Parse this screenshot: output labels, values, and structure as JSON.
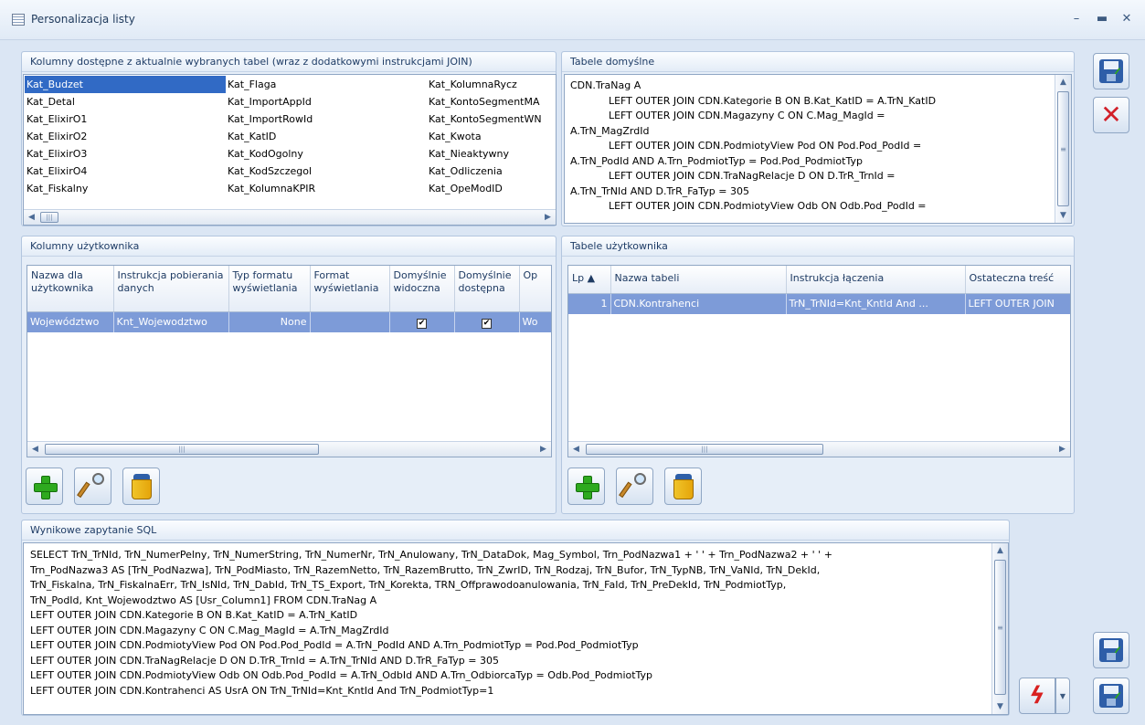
{
  "window": {
    "title": "Personalizacja listy"
  },
  "available_columns": {
    "title": "Kolumny dostępne z aktualnie wybranych tabel (wraz z dodatkowymi instrukcjami JOIN)",
    "columns": [
      [
        "Kat_Budzet",
        "Kat_Detal",
        "Kat_ElixirO1",
        "Kat_ElixirO2",
        "Kat_ElixirO3",
        "Kat_ElixirO4",
        "Kat_Fiskalny"
      ],
      [
        "Kat_Flaga",
        "Kat_ImportAppId",
        "Kat_ImportRowId",
        "Kat_KatID",
        "Kat_KodOgolny",
        "Kat_KodSzczegol",
        "Kat_KolumnaKPIR"
      ],
      [
        "Kat_KolumnaRycz",
        "Kat_KontoSegmentMA",
        "Kat_KontoSegmentWN",
        "Kat_Kwota",
        "Kat_Nieaktywny",
        "Kat_Odliczenia",
        "Kat_OpeModID"
      ]
    ],
    "selected": "Kat_Budzet"
  },
  "default_tables": {
    "title": "Tabele domyślne",
    "text": "CDN.TraNag A\n            LEFT OUTER JOIN CDN.Kategorie B ON B.Kat_KatID = A.TrN_KatID\n            LEFT OUTER JOIN CDN.Magazyny C ON C.Mag_MagId =\nA.TrN_MagZrdId\n            LEFT OUTER JOIN CDN.PodmiotyView Pod ON Pod.Pod_PodId =\nA.TrN_PodId AND A.Trn_PodmiotTyp = Pod.Pod_PodmiotTyp\n            LEFT OUTER JOIN CDN.TraNagRelacje D ON D.TrR_TrnId =\nA.TrN_TrNId AND D.TrR_FaTyp = 305\n            LEFT OUTER JOIN CDN.PodmiotyView Odb ON Odb.Pod_PodId ="
  },
  "user_columns": {
    "title": "Kolumny użytkownika",
    "headers": [
      "Nazwa dla użytkownika",
      "Instrukcja pobierania danych",
      "Typ formatu wyświetlania",
      "Format wyświetlania",
      "Domyślnie widoczna",
      "Domyślnie dostępna",
      "Op"
    ],
    "row": {
      "name": "Województwo",
      "instruction": "Knt_Wojewodztwo",
      "format_type": "None",
      "format": "",
      "visible": true,
      "available": true,
      "op": "Wo"
    }
  },
  "user_tables": {
    "title": "Tabele użytkownika",
    "headers": [
      "Lp ▲",
      "Nazwa tabeli",
      "Instrukcja łączenia",
      "Ostateczna treść"
    ],
    "row": {
      "lp": "1",
      "name": "CDN.Kontrahenci",
      "join": "TrN_TrNId=Knt_KntId And ...",
      "final": "LEFT OUTER JOIN"
    }
  },
  "sql": {
    "title": "Wynikowe zapytanie SQL",
    "text": "SELECT TrN_TrNId, TrN_NumerPelny, TrN_NumerString, TrN_NumerNr, TrN_Anulowany, TrN_DataDok, Mag_Symbol, Trn_PodNazwa1 + ' ' + Trn_PodNazwa2 + ' ' +\nTrn_PodNazwa3 AS [TrN_PodNazwa], TrN_PodMiasto, TrN_RazemNetto, TrN_RazemBrutto, TrN_ZwrID, TrN_Rodzaj, TrN_Bufor, TrN_TypNB, TrN_VaNId, TrN_DekId,\nTrN_Fiskalna, TrN_FiskalnaErr, TrN_IsNId, TrN_DabId, TrN_TS_Export, TrN_Korekta, TRN_Offprawodoanulowania, TrN_FaId, TrN_PreDekId, TrN_PodmiotTyp,\nTrN_PodId, Knt_Wojewodztwo AS [Usr_Column1] FROM CDN.TraNag A\nLEFT OUTER JOIN CDN.Kategorie B ON B.Kat_KatID = A.TrN_KatID\nLEFT OUTER JOIN CDN.Magazyny C ON C.Mag_MagId = A.TrN_MagZrdId\nLEFT OUTER JOIN CDN.PodmiotyView Pod ON Pod.Pod_PodId = A.TrN_PodId AND A.Trn_PodmiotTyp = Pod.Pod_PodmiotTyp\nLEFT OUTER JOIN CDN.TraNagRelacje D ON D.TrR_TrnId = A.TrN_TrNId AND D.TrR_FaTyp = 305\nLEFT OUTER JOIN CDN.PodmiotyView Odb ON Odb.Pod_PodId = A.TrN_OdbId AND A.Trn_OdbiorcaTyp = Odb.Pod_PodmiotTyp\nLEFT OUTER JOIN CDN.Kontrahenci AS UsrA ON TrN_TrNId=Knt_KntId And TrN_PodmiotTyp=1"
  },
  "icons": [
    "app-icon",
    "minimize-icon",
    "maximize-icon",
    "close-icon",
    "save-icon",
    "cancel-icon",
    "add-icon",
    "edit-icon",
    "delete-icon",
    "execute-icon",
    "save-as-icon",
    "export-icon"
  ],
  "colors": {
    "selection": "#316ac5",
    "row_selection": "#7d9bd8",
    "panel_bg": "#e6eef8",
    "accent_red": "#d2202a",
    "accent_green": "#2fa81e"
  }
}
